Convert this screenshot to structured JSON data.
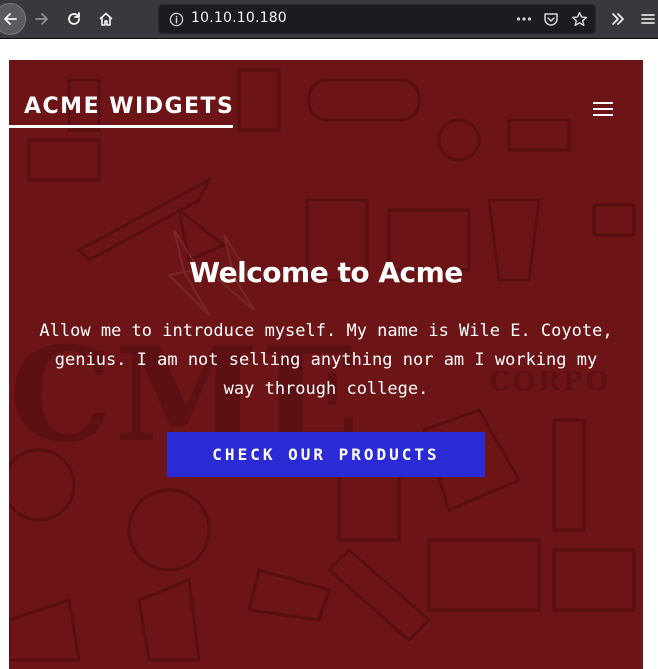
{
  "browser": {
    "url": "10.10.10.180",
    "icons": {
      "back": "back-arrow-icon",
      "forward": "forward-arrow-icon",
      "reload": "reload-icon",
      "home": "home-icon",
      "info": "info-icon",
      "more": "more-dots-icon",
      "pocket": "pocket-icon",
      "bookmark": "star-icon",
      "overflow": "double-chevron-icon",
      "menu": "hamburger-menu-icon"
    }
  },
  "site": {
    "brand": "ACME WIDGETS",
    "hero_title": "Welcome to Acme",
    "hero_text": "Allow me to introduce myself. My name is Wile E. Coyote, genius. I am not selling anything nor am I working my way through college.",
    "cta_label": "CHECK OUR PRODUCTS"
  },
  "colors": {
    "toolbar": "#38383d",
    "urlbar": "#1c1b22",
    "hero_background": "#6e1418",
    "cta_button": "#2b2bd6",
    "text": "#ffffff"
  }
}
